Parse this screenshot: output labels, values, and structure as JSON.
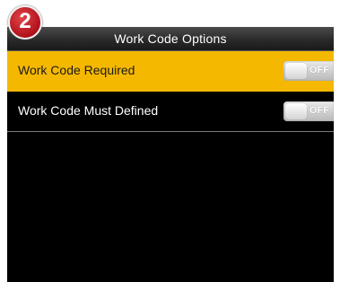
{
  "badge": {
    "number": "2",
    "color": "#c0141c"
  },
  "header": {
    "title": "Work Code Options"
  },
  "accent_color": "#f5b800",
  "options": [
    {
      "label": "Work Code Required",
      "state": "OFF",
      "selected": true
    },
    {
      "label": "Work Code Must Defined",
      "state": "OFF",
      "selected": false
    }
  ]
}
